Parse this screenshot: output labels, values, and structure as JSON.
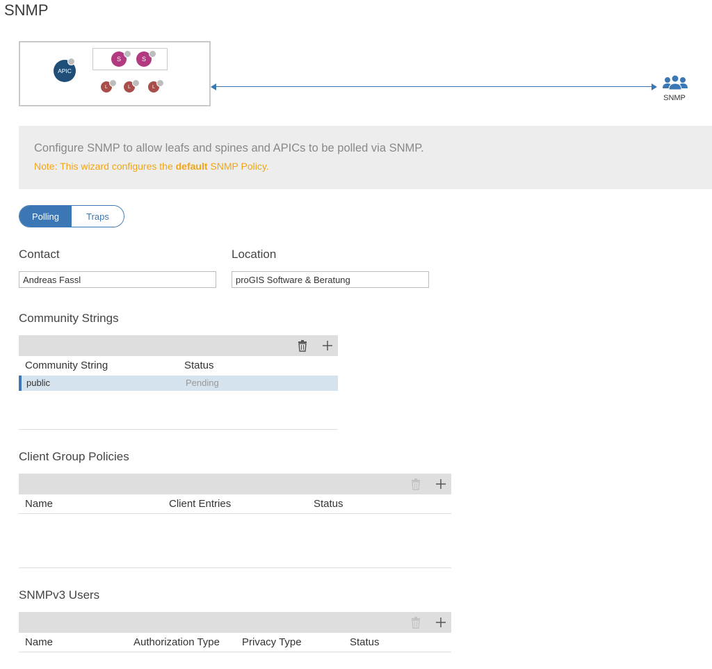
{
  "page": {
    "title": "SNMP"
  },
  "topology": {
    "apic_label": "APIC",
    "spines": [
      "S",
      "S"
    ],
    "leafs": [
      "L",
      "L",
      "L"
    ],
    "target_label": "SNMP"
  },
  "info": {
    "description": "Configure SNMP to allow leafs and spines and APICs to be polled via SNMP.",
    "note_prefix": "Note: This wizard configures the ",
    "note_bold": "default",
    "note_suffix": " SNMP Policy."
  },
  "tabs": [
    {
      "label": "Polling",
      "active": true
    },
    {
      "label": "Traps",
      "active": false
    }
  ],
  "contact": {
    "label": "Contact",
    "value": "Andreas Fassl"
  },
  "location": {
    "label": "Location",
    "value": "proGIS Software & Beratung"
  },
  "community": {
    "title": "Community Strings",
    "columns": [
      "Community String",
      "Status"
    ],
    "rows": [
      {
        "name": "public",
        "status": "Pending"
      }
    ]
  },
  "client_groups": {
    "title": "Client Group Policies",
    "columns": [
      "Name",
      "Client Entries",
      "Status"
    ]
  },
  "snmpv3": {
    "title": "SNMPv3 Users",
    "columns": [
      "Name",
      "Authorization Type",
      "Privacy Type",
      "Status"
    ]
  },
  "colors": {
    "accent": "#3b77b5",
    "apic": "#1f4e79",
    "spine": "#b23a80",
    "leaf": "#a84e4a",
    "note": "#f0a514",
    "toolbar": "#dedede",
    "selected_row": "#d5e3ee"
  },
  "icons": {
    "delete": "trash-icon",
    "add": "plus-icon",
    "snmp": "users-group-icon"
  }
}
